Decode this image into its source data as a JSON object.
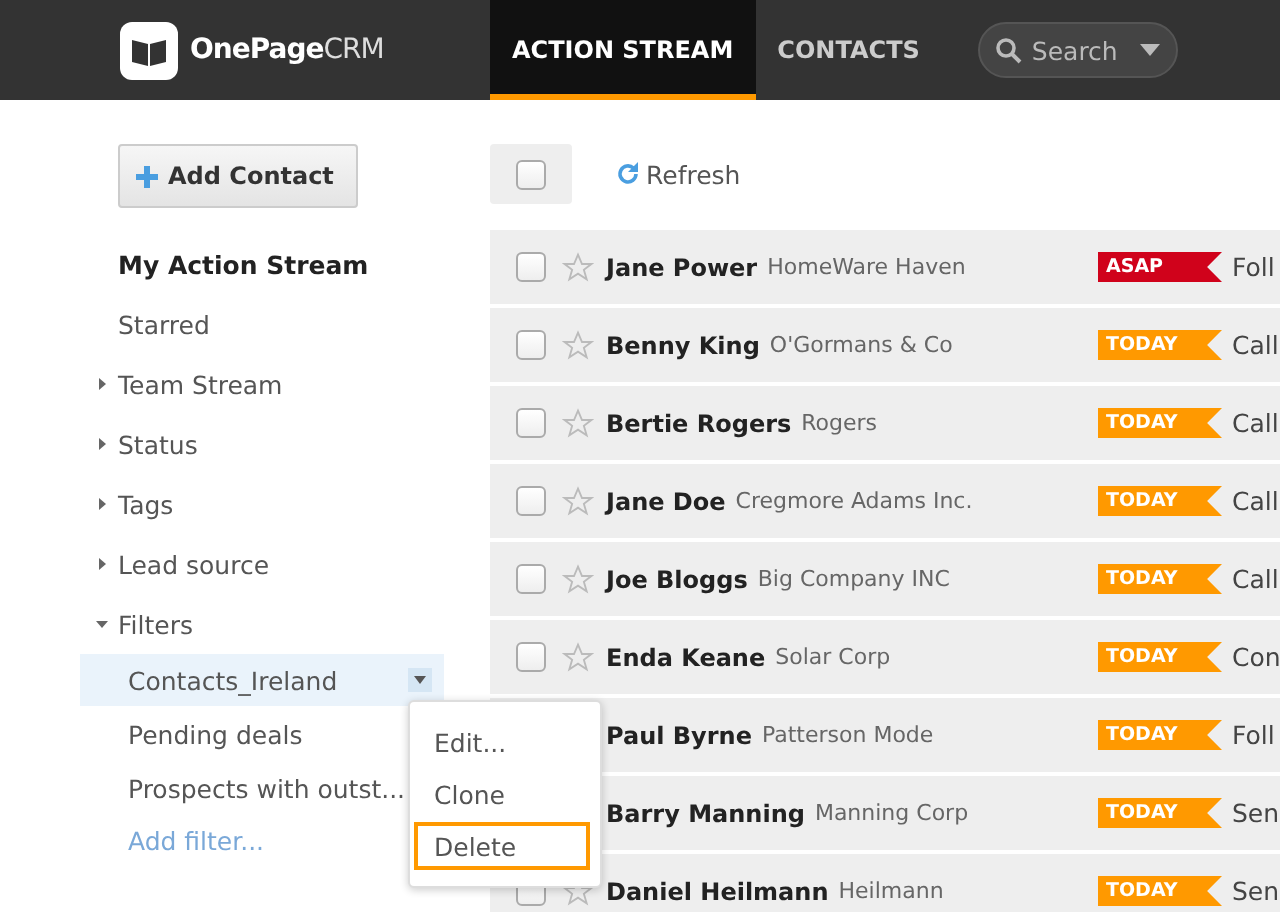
{
  "header": {
    "logo": {
      "brand": "OnePage",
      "suffix": "CRM"
    },
    "tabs": [
      {
        "label": "ACTION STREAM",
        "selected": true
      },
      {
        "label": "CONTACTS",
        "selected": false
      }
    ],
    "search": {
      "placeholder": "Search"
    }
  },
  "sidebar": {
    "add_button": "Add Contact",
    "items": [
      {
        "label": "My Action Stream",
        "selected": true
      },
      {
        "label": "Starred",
        "selected": false
      },
      {
        "label": "Team Stream",
        "selected": false,
        "expanded": false
      },
      {
        "label": "Status",
        "selected": false,
        "expanded": false
      },
      {
        "label": "Tags",
        "selected": false,
        "expanded": false
      },
      {
        "label": "Lead source",
        "selected": false,
        "expanded": false
      },
      {
        "label": "Filters",
        "selected": false,
        "expanded": true,
        "children": [
          {
            "label": "Contacts_Ireland",
            "selected": true
          },
          {
            "label": "Pending deals",
            "selected": false
          },
          {
            "label": "Prospects with outst...",
            "selected": false
          }
        ],
        "add_link": "Add filter..."
      }
    ],
    "context_menu": {
      "items": [
        {
          "label": "Edit...",
          "highlighted": false
        },
        {
          "label": "Clone",
          "highlighted": false
        },
        {
          "label": "Delete",
          "highlighted": true
        }
      ]
    }
  },
  "toolbar": {
    "select_all": {
      "checked": false
    },
    "refresh": "Refresh"
  },
  "rows": [
    {
      "name": "Jane Power",
      "company": "HomeWare Haven",
      "tag": {
        "label": "ASAP",
        "color": "#d0021b"
      },
      "action": "Foll",
      "checked": false,
      "starred": false
    },
    {
      "name": "Benny King",
      "company": "O'Gormans & Co",
      "tag": {
        "label": "TODAY",
        "color": "#ff9900"
      },
      "action": "Call",
      "checked": false,
      "starred": false
    },
    {
      "name": "Bertie Rogers",
      "company": "Rogers",
      "tag": {
        "label": "TODAY",
        "color": "#ff9900"
      },
      "action": "Call",
      "checked": false,
      "starred": false
    },
    {
      "name": "Jane Doe",
      "company": "Cregmore Adams Inc.",
      "tag": {
        "label": "TODAY",
        "color": "#ff9900"
      },
      "action": "Call",
      "checked": false,
      "starred": false
    },
    {
      "name": "Joe Bloggs",
      "company": "Big Company INC",
      "tag": {
        "label": "TODAY",
        "color": "#ff9900"
      },
      "action": "Call",
      "checked": false,
      "starred": false
    },
    {
      "name": "Enda Keane",
      "company": "Solar Corp",
      "tag": {
        "label": "TODAY",
        "color": "#ff9900"
      },
      "action": "Con",
      "checked": false,
      "starred": false
    },
    {
      "name": "Paul Byrne",
      "company": "Patterson Mode",
      "tag": {
        "label": "TODAY",
        "color": "#ff9900"
      },
      "action": "Foll"
    },
    {
      "name": "Barry Manning",
      "company": "Manning Corp",
      "tag": {
        "label": "TODAY",
        "color": "#ff9900"
      },
      "action": "Sen"
    },
    {
      "name": "Daniel Heilmann",
      "company": "Heilmann",
      "tag": {
        "label": "TODAY",
        "color": "#ff9900"
      },
      "action": "Sen",
      "checked": false,
      "starred": false
    }
  ]
}
